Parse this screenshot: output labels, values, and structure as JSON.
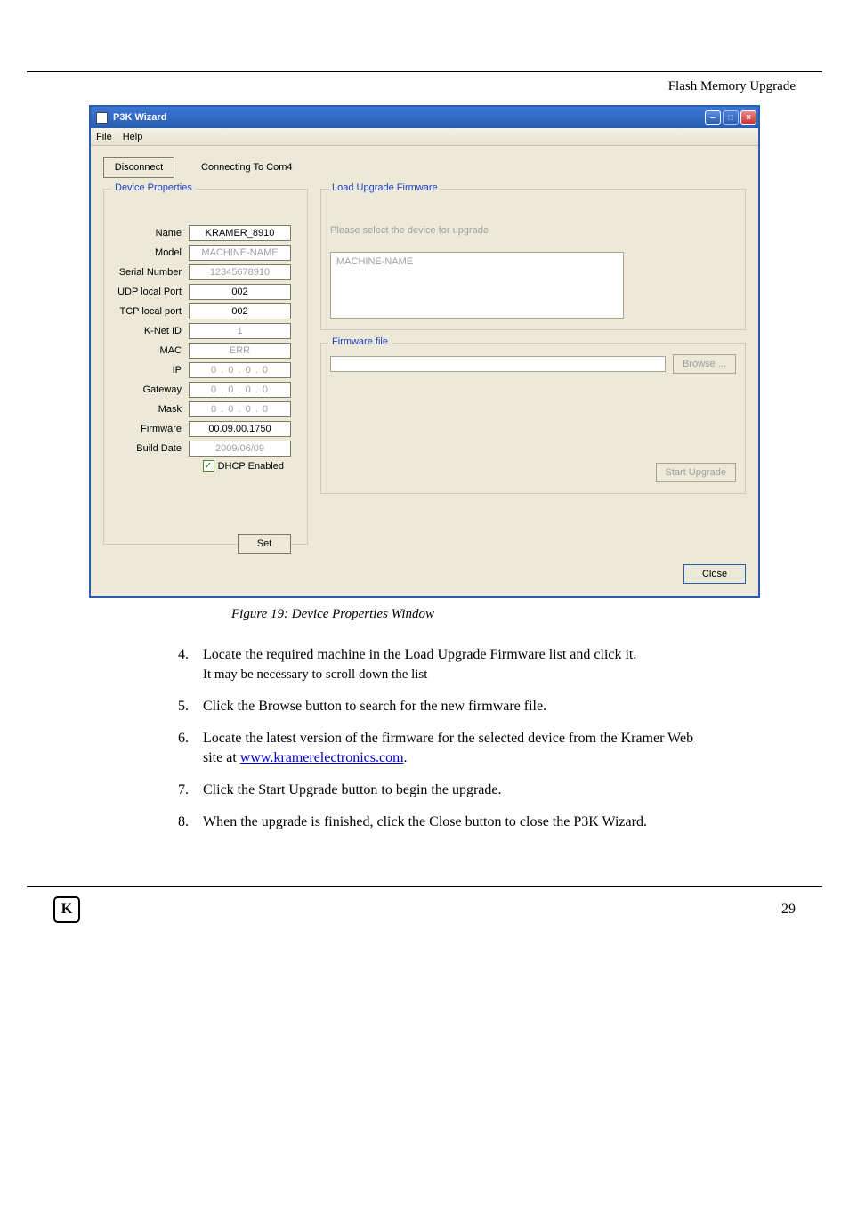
{
  "header": "Flash Memory Upgrade",
  "window": {
    "title": "P3K Wizard",
    "menu": {
      "file": "File",
      "help": "Help"
    },
    "win_btns": {
      "min": "–",
      "max": "□",
      "close": "×"
    }
  },
  "toolbar": {
    "disconnect_label": "Disconnect",
    "status": "Connecting To Com4"
  },
  "device_props": {
    "legend": "Device Properties",
    "rows": {
      "name": {
        "label": "Name",
        "value": "KRAMER_8910"
      },
      "model": {
        "label": "Model",
        "value": "MACHINE-NAME"
      },
      "serial": {
        "label": "Serial Number",
        "value": "12345678910"
      },
      "udp": {
        "label": "UDP local Port",
        "value": "002"
      },
      "tcp": {
        "label": "TCP local port",
        "value": "002"
      },
      "knet": {
        "label": "K-Net ID",
        "value": "1"
      },
      "mac": {
        "label": "MAC",
        "value": "ERR"
      },
      "ip": {
        "label": "IP",
        "value": "0  .   0  .   0  .   0"
      },
      "gateway": {
        "label": "Gateway",
        "value": "0  .   0  .   0  .   0"
      },
      "mask": {
        "label": "Mask",
        "value": "0  .   0  .   0  .   0"
      },
      "firmware": {
        "label": "Firmware",
        "value": "00.09.00.1750"
      },
      "build": {
        "label": "Build Date",
        "value": "2009/06/09"
      }
    },
    "dhcp_label": "DHCP Enabled",
    "set_label": "Set"
  },
  "upgrade": {
    "legend": "Load Upgrade Firmware",
    "select_prompt": "Please select the device for upgrade",
    "device_item": "MACHINE-NAME",
    "file_legend": "Firmware file",
    "browse_label": "Browse ...",
    "start_label": "Start Upgrade"
  },
  "close_label": "Close",
  "caption": "Figure 19: Device Properties Window",
  "steps": {
    "s4": {
      "text": "Locate the required machine in the Load Upgrade Firmware list and click it.",
      "sub": "It may be necessary to scroll down the list"
    },
    "s5": {
      "text": "Click the Browse button to search for the new firmware file."
    },
    "s6": {
      "text": "Locate the latest version of the firmware for the selected device from the Kramer Web site at ",
      "link": "www.kramerelectronics.com"
    },
    "s7": {
      "text": "Click the Start Upgrade button to begin the upgrade."
    },
    "s8": {
      "text": "When the upgrade is finished, click the Close button to close the P3K Wizard."
    }
  },
  "page_number": "29"
}
